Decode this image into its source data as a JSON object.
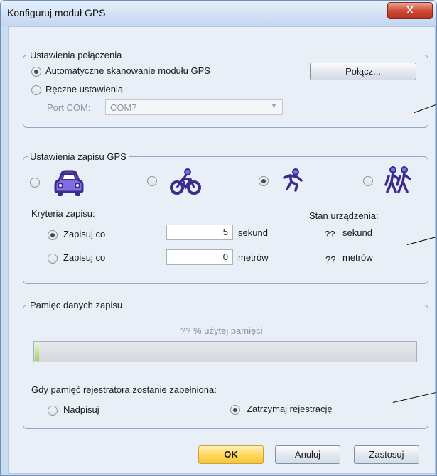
{
  "window": {
    "title": "Konfiguruj moduł GPS",
    "close_glyph": "X"
  },
  "connection": {
    "legend": "Ustawienia połączenia",
    "auto_label": "Automatyczne skanowanie modułu GPS",
    "manual_label": "Ręczne ustawienia",
    "port_label": "Port COM:",
    "port_value": "COM7",
    "connect_button": "Połącz..."
  },
  "logging": {
    "legend": "Ustawienia zapisu GPS",
    "modes": [
      {
        "icon": "car-icon",
        "selected": false
      },
      {
        "icon": "bicycle-icon",
        "selected": false
      },
      {
        "icon": "runner-icon",
        "selected": true
      },
      {
        "icon": "hikers-icon",
        "selected": false
      }
    ],
    "criteria_label": "Kryteria zapisu:",
    "every_time_label": "Zapisuj co",
    "every_time_value": "5",
    "every_time_unit": "sekund",
    "every_distance_label": "Zapisuj co",
    "every_distance_value": "0",
    "every_distance_unit": "metrów",
    "status_title": "Stan urządzenia:",
    "status_time_value": "??",
    "status_time_unit": "sekund",
    "status_distance_value": "??",
    "status_distance_unit": "metrów"
  },
  "memory": {
    "legend": "Pamięc danych zapisu",
    "usage_text": "?? % użytej pamięci",
    "usage_fraction": 0.01,
    "full_label": "Gdy pamięć rejestratora zostanie zapełniona:",
    "overwrite_label": "Nadpisuj",
    "stop_label": "Zatrzymaj rejestrację"
  },
  "buttons": {
    "ok": "OK",
    "cancel": "Anuluj",
    "apply": "Zastosuj"
  },
  "colors": {
    "icon_purple": "#3c2a8c",
    "icon_fill": "#7d6fe0"
  }
}
